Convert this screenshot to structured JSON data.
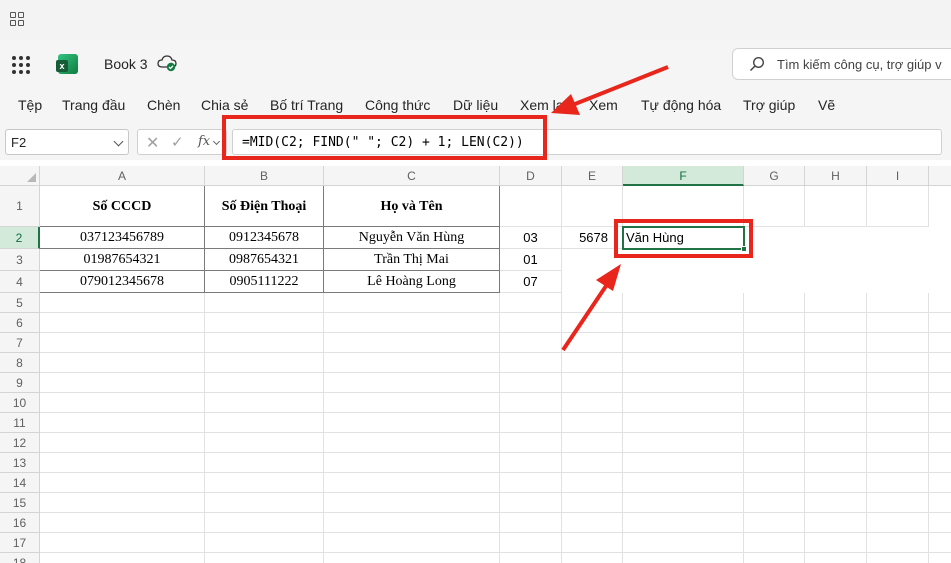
{
  "system_bar": {
    "icon": "grid-apps-icon"
  },
  "header": {
    "waffle_icon": "app-launcher-icon",
    "app_icon": "excel-logo-icon",
    "book_title": "Book 3",
    "save_status_icon": "cloud-saved-icon",
    "search": {
      "placeholder": "Tìm kiếm công cụ, trợ giúp v",
      "icon": "search-icon"
    }
  },
  "ribbon": {
    "tabs": [
      "Tệp",
      "Trang đầu",
      "Chèn",
      "Chia sẻ",
      "Bố trí Trang",
      "Công thức",
      "Dữ liệu",
      "Xem lạ",
      "Xem",
      "Tự động hóa",
      "Trợ giúp",
      "Vẽ"
    ]
  },
  "formula_bar": {
    "name_box": "F2",
    "cancel_glyph": "✕",
    "enter_glyph": "✓",
    "fx_label": "fx",
    "formula": "=MID(C2; FIND(\" \"; C2) + 1; LEN(C2))"
  },
  "sheet": {
    "columns": [
      "A",
      "B",
      "C",
      "D",
      "E",
      "F",
      "G",
      "H",
      "I"
    ],
    "selected_column": "F",
    "rows": [
      "1",
      "2",
      "3",
      "4",
      "5",
      "6",
      "7",
      "8",
      "9",
      "10",
      "11",
      "12",
      "13",
      "14",
      "15",
      "16",
      "17",
      "18"
    ],
    "selected_row": "2",
    "header_row": {
      "A": "Số CCCD",
      "B": "Số Điện Thoại",
      "C": "Họ và Tên"
    },
    "data_rows": [
      {
        "A": "037123456789",
        "B": "0912345678",
        "C": "Nguyễn Văn Hùng",
        "D": "03",
        "E": "5678",
        "F": "Văn Hùng"
      },
      {
        "A": "01987654321",
        "B": "0987654321",
        "C": "Trần Thị Mai",
        "D": "01",
        "E": "",
        "F": ""
      },
      {
        "A": "079012345678",
        "B": "0905111222",
        "C": "Lê Hoàng Long",
        "D": "07",
        "E": "",
        "F": ""
      }
    ],
    "active_cell": "F2"
  },
  "annotation_color": "#e8261c",
  "accent_color": "#217346"
}
